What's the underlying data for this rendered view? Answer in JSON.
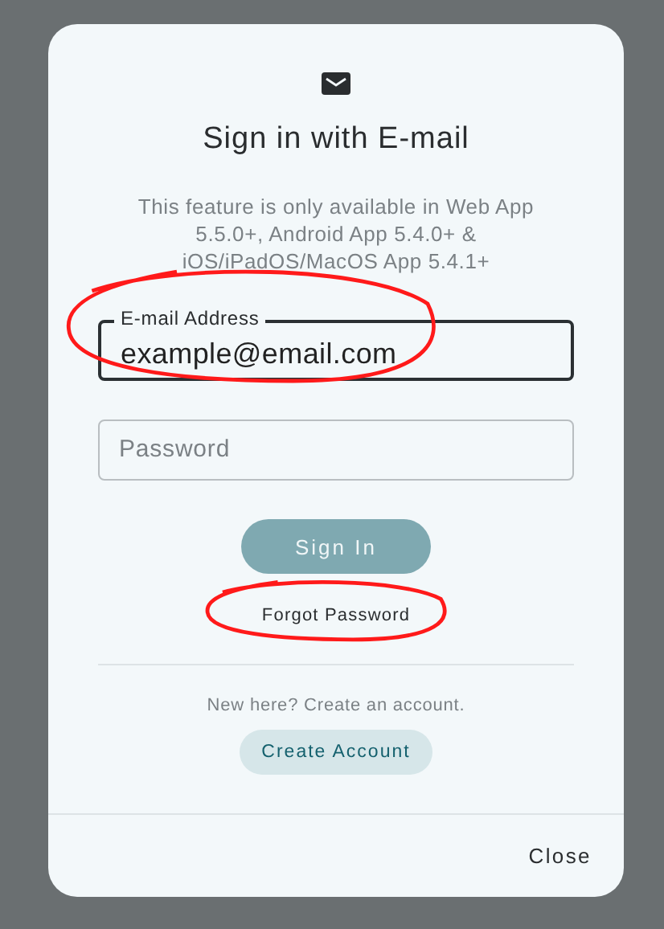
{
  "dialog": {
    "title": "Sign in with E-mail",
    "description": "This feature is only available in Web App 5.5.0+, Android App 5.4.0+ & iOS/iPadOS/MacOS App 5.4.1+"
  },
  "fields": [
    {
      "label": "E-mail Address",
      "value": "example@email.com",
      "focused": true,
      "circled": true
    },
    {
      "placeholder": "Password",
      "focused": false,
      "circled": false
    }
  ],
  "sign_in_button": {
    "label": "Sign In",
    "disabled": true
  },
  "forgot_link": {
    "label": "Forgot Password",
    "circled": true
  },
  "signup": {
    "prompt": "New here? Create an account.",
    "button": "Create Account"
  },
  "footer": {
    "close": "Close"
  }
}
